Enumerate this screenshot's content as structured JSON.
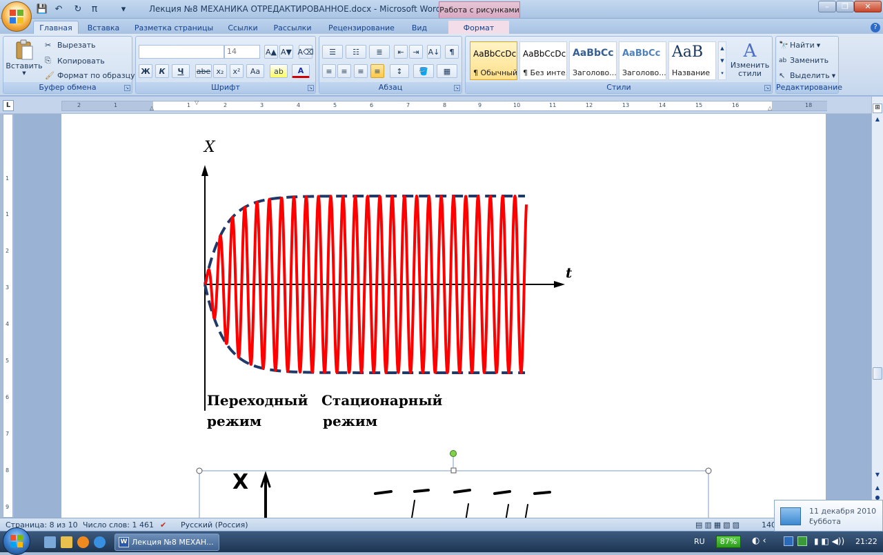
{
  "window": {
    "title": "Лекция №8 МЕХАНИКА ОТРЕДАКТИРОВАННОЕ.docx - Microsoft Word",
    "context_tab": "Работа с рисунками",
    "min": "–",
    "max": "❐",
    "close": "✕"
  },
  "qat": {
    "save": "💾",
    "undo": "↶",
    "redo": "↻",
    "pi": "π",
    "more": "▾"
  },
  "tabs": [
    {
      "label": "Главная"
    },
    {
      "label": "Вставка"
    },
    {
      "label": "Разметка страницы"
    },
    {
      "label": "Ссылки"
    },
    {
      "label": "Рассылки"
    },
    {
      "label": "Рецензирование"
    },
    {
      "label": "Вид"
    },
    {
      "label": "Формат"
    }
  ],
  "clipboard": {
    "paste": "Вставить",
    "cut": "Вырезать",
    "copy": "Копировать",
    "format_painter": "Формат по образцу",
    "label": "Буфер обмена"
  },
  "font": {
    "name": "",
    "size": "14",
    "label": "Шрифт",
    "bold": "Ж",
    "italic": "К",
    "underline": "Ч",
    "strike": "abe",
    "sub": "x₂",
    "sup": "x²",
    "case": "Aa",
    "grow": "A▲",
    "shrink": "A▼",
    "clear": "A⌫",
    "highlight": "ab",
    "color": "A"
  },
  "paragraph": {
    "label": "Абзац",
    "sort": "A↓",
    "marks": "¶"
  },
  "styles": {
    "label": "Стили",
    "items": [
      {
        "sample": "AaBbCcDc",
        "name": "¶ Обычный"
      },
      {
        "sample": "AaBbCcDc",
        "name": "¶ Без инте..."
      },
      {
        "sample": "AaBbCc",
        "name": "Заголово..."
      },
      {
        "sample": "AaBbCc",
        "name": "Заголово..."
      },
      {
        "sample": "AaB",
        "name": "Название"
      }
    ],
    "change": "Изменить стили"
  },
  "editing": {
    "label": "Редактирование",
    "find": "Найти",
    "replace": "Заменить",
    "select": "Выделить"
  },
  "ruler": {
    "numbers": [
      "2",
      "1",
      "1",
      "2",
      "3",
      "4",
      "5",
      "6",
      "7",
      "8",
      "9",
      "10",
      "11",
      "12",
      "13",
      "14",
      "15",
      "16",
      "18"
    ],
    "vnumbers": [
      "1",
      "1",
      "2",
      "3",
      "4",
      "5",
      "6",
      "7",
      "8",
      "9",
      "10"
    ]
  },
  "document": {
    "axis_x": "X",
    "axis_t": "t",
    "label1_line1": "Переходный",
    "label1_line2": "режим",
    "label2_line1": "Стационарный",
    "label2_line2": "режим",
    "handwritten_x": "X"
  },
  "status": {
    "page": "Страница: 8 из 10",
    "words": "Число слов: 1 461",
    "lang": "Русский (Россия)",
    "zoom": "140"
  },
  "taskbar": {
    "task": "Лекция №8 МЕХАН...",
    "lang": "RU",
    "battery": "87%",
    "time": "21:22"
  },
  "notification": {
    "date": "11 декабря 2010 г.",
    "day": "суббота"
  },
  "colors": {
    "accent": "#15428b",
    "curve": "#ff0000",
    "envelope": "#1f3a68"
  }
}
